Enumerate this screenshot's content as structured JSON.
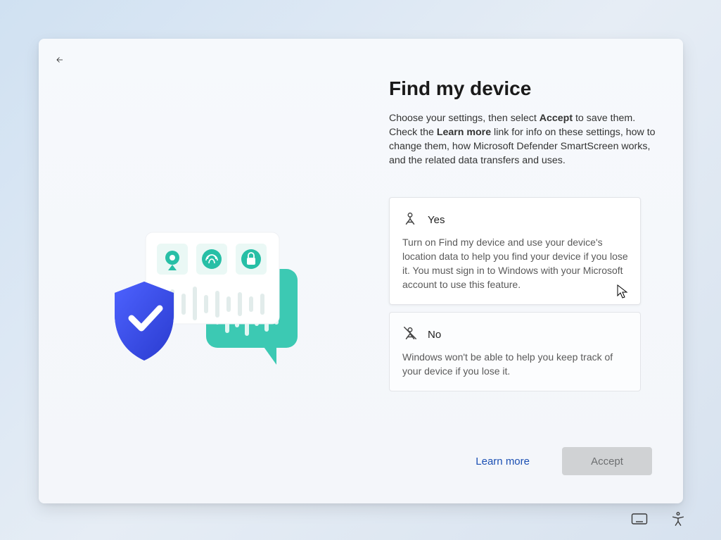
{
  "title": "Find my device",
  "description": {
    "part1": "Choose your settings, then select ",
    "bold1": "Accept",
    "part2": " to save them. Check the ",
    "bold2": "Learn more",
    "part3": " link for info on these settings, how to change them, how Microsoft Defender SmartScreen works, and the related data transfers and uses."
  },
  "options": {
    "yes": {
      "label": "Yes",
      "desc": "Turn on Find my device and use your device's location data to help you find your device if you lose it. You must sign in to Windows with your Microsoft account to use this feature."
    },
    "no": {
      "label": "No",
      "desc": "Windows won't be able to help you keep track of your device if you lose it."
    }
  },
  "footer": {
    "learn_more": "Learn more",
    "accept": "Accept"
  },
  "colors": {
    "shield": "#3a4fd9",
    "teal": "#3cc9b3",
    "link": "#1b4fb3"
  }
}
